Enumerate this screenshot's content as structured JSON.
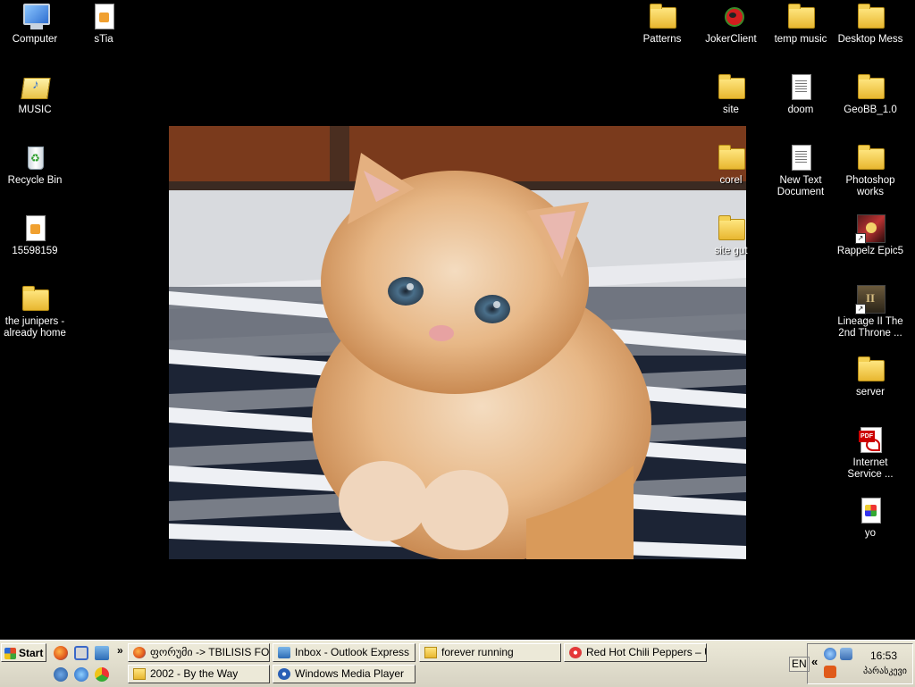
{
  "desktop": {
    "icons": [
      {
        "label": "Computer",
        "icon": "computer-icon"
      },
      {
        "label": "sTia",
        "icon": "file-icon"
      },
      {
        "label": "MUSIC",
        "icon": "music-folder-icon"
      },
      {
        "label": "Recycle Bin",
        "icon": "recycle-bin-icon"
      },
      {
        "label": "15598159",
        "icon": "file-icon"
      },
      {
        "label": "the junipers - already home",
        "icon": "folder-icon"
      },
      {
        "label": "Patterns",
        "icon": "folder-icon"
      },
      {
        "label": "JokerClient",
        "icon": "joker-icon"
      },
      {
        "label": "temp music",
        "icon": "folder-icon"
      },
      {
        "label": "Desktop Mess",
        "icon": "folder-icon"
      },
      {
        "label": "site",
        "icon": "folder-icon"
      },
      {
        "label": "doom",
        "icon": "text-document-icon"
      },
      {
        "label": "GeoBB_1.0",
        "icon": "folder-icon"
      },
      {
        "label": "corel",
        "icon": "folder-icon"
      },
      {
        "label": "New Text Document",
        "icon": "text-document-icon"
      },
      {
        "label": "Photoshop works",
        "icon": "folder-icon"
      },
      {
        "label": "site gut",
        "icon": "folder-icon"
      },
      {
        "label": "Rappelz Epic5",
        "icon": "game-shortcut-icon"
      },
      {
        "label": "Lineage II The 2nd Throne ...",
        "icon": "game-shortcut-icon"
      },
      {
        "label": "server",
        "icon": "folder-icon"
      },
      {
        "label": "Internet Service ...",
        "icon": "pdf-icon"
      },
      {
        "label": "yo",
        "icon": "image-file-icon"
      }
    ]
  },
  "taskbar": {
    "start_label": "Start",
    "quick_launch_more": "»",
    "tasks": [
      {
        "label": "ფორუმი -> TBILISIS FORU...",
        "icon": "firefox-icon"
      },
      {
        "label": "Inbox - Outlook Express",
        "icon": "outlook-icon"
      },
      {
        "label": "forever running",
        "icon": "folder-icon"
      },
      {
        "label": "Red Hot Chili Peppers – U...",
        "icon": "media-icon"
      },
      {
        "label": "2002 - By the Way",
        "icon": "folder-icon"
      },
      {
        "label": "Windows Media Player",
        "icon": "wmp-icon"
      }
    ],
    "language": "EN",
    "tray_expand": "«",
    "clock": "16:53",
    "date": "პარასკევი"
  },
  "colors": {
    "desktop_bg": "#000000",
    "taskbar_bg": "#ece9d8"
  }
}
